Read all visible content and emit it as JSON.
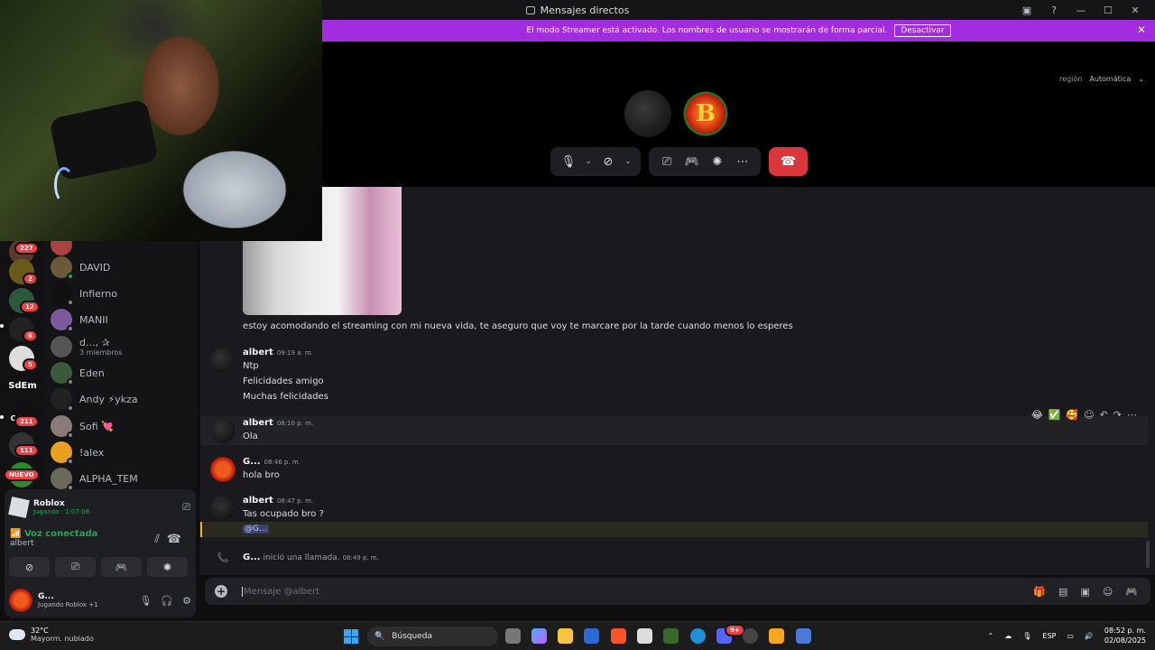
{
  "window": {
    "title": "Mensajes directos"
  },
  "banner": {
    "text": "El modo Streamer está activado. Los nombres de usuario se mostrarán de forma parcial.",
    "button": "Desactivar"
  },
  "call": {
    "region_label": "región",
    "region_value": "Automática",
    "avatar_text": "B"
  },
  "servers": [
    {
      "badge": "227"
    },
    {
      "badge": "2"
    },
    {
      "badge": "12"
    },
    {
      "badge": "6"
    },
    {
      "badge": "5"
    },
    {
      "label": "SdEm"
    },
    {
      "label": "C.M.L",
      "badge": "211"
    },
    {
      "badge": "111"
    },
    {
      "badge": "NUEVO"
    }
  ],
  "dms": [
    {
      "name": "DAVID",
      "status": "online"
    },
    {
      "name": "Infierno",
      "status": "offline"
    },
    {
      "name": "MANII",
      "status": "offline"
    },
    {
      "name": "d..., ✰",
      "sub": "3 miembros"
    },
    {
      "name": "Eden",
      "status": "offline"
    },
    {
      "name": "Andy ⚡ykza",
      "status": "offline"
    },
    {
      "name": "Sofi 💘",
      "status": "offline"
    },
    {
      "name": "!alex",
      "status": "offline"
    },
    {
      "name": "ALPHA_TEM",
      "status": "offline"
    }
  ],
  "panel": {
    "activity_title": "Roblox",
    "activity_sub": "Jugando · 1:07:08",
    "voice_status": "Voz conectada",
    "voice_user": "albert",
    "me_name": "G...",
    "me_status": "Jugando Roblox",
    "me_extra": "+1"
  },
  "messages": {
    "caption": "estoy acomodando el streaming con mi nueva vida, te aseguro que voy te marcare por la tarde cuando menos lo esperes",
    "m1_author": "albert",
    "m1_time": "09:19 a. m.",
    "m1_lines": [
      "Ntp",
      "Felicidades amigo",
      "Muchas felicidades"
    ],
    "m2_author": "albert",
    "m2_time": "08:10 p. m.",
    "m2_text": "Ola",
    "m3_author": "G...",
    "m3_time": "08:46 p. m.",
    "m3_text": "hola bro",
    "m4_author": "albert",
    "m4_time": "08:47 p. m.",
    "m4_text": "Tas ocupado bro ?",
    "mention": "@G...",
    "call_author": "G...",
    "call_text": "inició una llamada.",
    "call_time": "08:49 p. m."
  },
  "input": {
    "placeholder": "Mensaje @albert"
  },
  "taskbar": {
    "temp": "32°C",
    "weather": "Mayorm. nublado",
    "search": "Búsqueda",
    "lang": "ESP",
    "time": "08:52 p. m.",
    "date": "02/08/2025",
    "discord_badge": "9+"
  }
}
